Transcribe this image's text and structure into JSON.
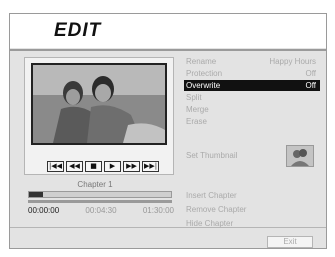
{
  "window": {
    "title": "Edit"
  },
  "preview": {
    "image": "two people at beach photo"
  },
  "transport": {
    "buttons": [
      {
        "name": "skip-back-button",
        "glyph": "|◀◀"
      },
      {
        "name": "rewind-button",
        "glyph": "◀◀"
      },
      {
        "name": "stop-button",
        "glyph": "■"
      },
      {
        "name": "play-button",
        "glyph": "▶"
      },
      {
        "name": "fast-forward-button",
        "glyph": "▶▶"
      },
      {
        "name": "skip-forward-button",
        "glyph": "▶▶|"
      }
    ]
  },
  "timeline": {
    "chapter_label": "Chapter 1",
    "progress": 0.1,
    "times": {
      "current": "00:00:00",
      "marker": "00:04:30",
      "total": "01:30:00"
    }
  },
  "menu": {
    "rename": {
      "label": "Rename",
      "value": "Happy Hours"
    },
    "protection": {
      "label": "Protection",
      "value": "Off"
    },
    "overwrite": {
      "label": "Overwrite",
      "value": "Off"
    },
    "split": {
      "label": "Split"
    },
    "merge": {
      "label": "Merge"
    },
    "erase": {
      "label": "Erase"
    },
    "set_thumbnail": {
      "label": "Set Thumbnail"
    },
    "insert_chapter": {
      "label": "Insert Chapter"
    },
    "remove_chapter": {
      "label": "Remove Chapter"
    },
    "hide_chapter": {
      "label": "Hide Chapter"
    }
  },
  "footer": {
    "exit_label": "Exit"
  }
}
